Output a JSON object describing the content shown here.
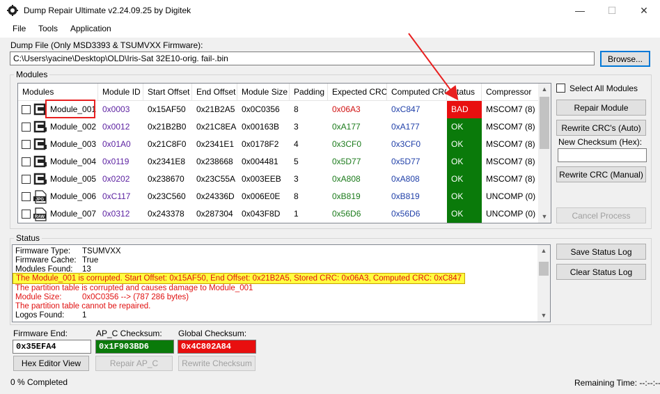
{
  "window": {
    "title": "Dump Repair Ultimate v2.24.09.25 by Digitek",
    "minimize": "—",
    "maximize": "☐",
    "close": "✕"
  },
  "menu": [
    "File",
    "Tools",
    "Application"
  ],
  "dump": {
    "label": "Dump File (Only MSD3393 & TSUMVXX Firmware):",
    "path": "C:\\Users\\yacine\\Desktop\\OLD\\Iris-Sat 32E10-orig. fail-.bin",
    "browse": "Browse..."
  },
  "modules": {
    "group_title": "Modules",
    "columns": [
      "Modules",
      "Module ID",
      "Start Offset",
      "End Offset",
      "Module Size",
      "Padding",
      "Expected CRC",
      "Computed CRC",
      "Status",
      "Compressor"
    ],
    "rows": [
      {
        "name": "Module_001",
        "id": "0x0003",
        "start": "0x15AF50",
        "end": "0x21B2A5",
        "size": "0x0C0356",
        "padding": "8",
        "expected": "0x06A3",
        "computed": "0xC847",
        "status": "BAD",
        "compressor": "MSCOM7 (8)",
        "icon": "module-icon"
      },
      {
        "name": "Module_002",
        "id": "0x0012",
        "start": "0x21B2B0",
        "end": "0x21C8EA",
        "size": "0x00163B",
        "padding": "3",
        "expected": "0xA177",
        "computed": "0xA177",
        "status": "OK",
        "compressor": "MSCOM7 (8)",
        "icon": "module-icon"
      },
      {
        "name": "Module_003",
        "id": "0x01A0",
        "start": "0x21C8F0",
        "end": "0x2341E1",
        "size": "0x0178F2",
        "padding": "4",
        "expected": "0x3CF0",
        "computed": "0x3CF0",
        "status": "OK",
        "compressor": "MSCOM7 (8)",
        "icon": "module-icon"
      },
      {
        "name": "Module_004",
        "id": "0x0119",
        "start": "0x2341E8",
        "end": "0x238668",
        "size": "0x004481",
        "padding": "5",
        "expected": "0x5D77",
        "computed": "0x5D77",
        "status": "OK",
        "compressor": "MSCOM7 (8)",
        "icon": "module-icon"
      },
      {
        "name": "Module_005",
        "id": "0x0202",
        "start": "0x238670",
        "end": "0x23C55A",
        "size": "0x003EEB",
        "padding": "3",
        "expected": "0xA808",
        "computed": "0xA808",
        "status": "OK",
        "compressor": "MSCOM7 (8)",
        "icon": "module-icon"
      },
      {
        "name": "Module_006",
        "id": "0xC117",
        "start": "0x23C560",
        "end": "0x24336D",
        "size": "0x006E0E",
        "padding": "8",
        "expected": "0xB819",
        "computed": "0xB819",
        "status": "OK",
        "compressor": "UNCOMP (0)",
        "icon": "jpg-file-icon",
        "icon_text": "JPG"
      },
      {
        "name": "Module_007",
        "id": "0x0312",
        "start": "0x243378",
        "end": "0x287304",
        "size": "0x043F8D",
        "padding": "1",
        "expected": "0x56D6",
        "computed": "0x56D6",
        "status": "OK",
        "compressor": "UNCOMP (0)",
        "icon": "raw-file-icon",
        "icon_text": "RAW"
      }
    ]
  },
  "side": {
    "select_all": "Select All Modules",
    "repair": "Repair Module",
    "rewrite_auto": "Rewrite CRC's (Auto)",
    "new_checksum_label": "New Checksum (Hex):",
    "new_checksum_value": "",
    "rewrite_manual": "Rewrite CRC (Manual)",
    "cancel": "Cancel Process",
    "save_log": "Save Status Log",
    "clear_log": "Clear Status Log"
  },
  "status": {
    "group_title": "Status",
    "lines": {
      "fw_type_label": "Firmware Type:",
      "fw_type_value": "TSUMVXX",
      "fw_cache_label": "Firmware Cache:",
      "fw_cache_value": "True",
      "modules_found_label": "Modules Found:",
      "modules_found_value": "13",
      "corrupt_msg": "The Module_001 is corrupted. Start Offset: 0x15AF50, End Offset: 0x21B2A5, Stored CRC: 0x06A3, Computed CRC: 0xC847",
      "partition_msg": "The partition table is corrupted and causes damage to Module_001",
      "module_size_label": "Module Size:",
      "module_size_value": "0x0C0356 --> (787 286 bytes)",
      "cannot_repair": "The partition table cannot be repaired.",
      "logos_label": "Logos Found:",
      "logos_value": "1"
    }
  },
  "bottom": {
    "fw_end_label": "Firmware End:",
    "fw_end_value": "0x35EFA4",
    "apc_label": "AP_C Checksum:",
    "apc_value": "0x1F903BD6",
    "global_label": "Global Checksum:",
    "global_value": "0x4C802A84",
    "hex_editor": "Hex Editor View",
    "repair_apc": "Repair AP_C",
    "rewrite_checksum": "Rewrite Checksum",
    "progress": "0 % Completed",
    "remaining": "Remaining Time: --:--:--"
  },
  "colors": {
    "ok": "#0a7a0a",
    "bad": "#e80f0f",
    "apc_bg": "#0a7a0a",
    "global_bg": "#e80f0f",
    "annotation": "#e82020"
  }
}
